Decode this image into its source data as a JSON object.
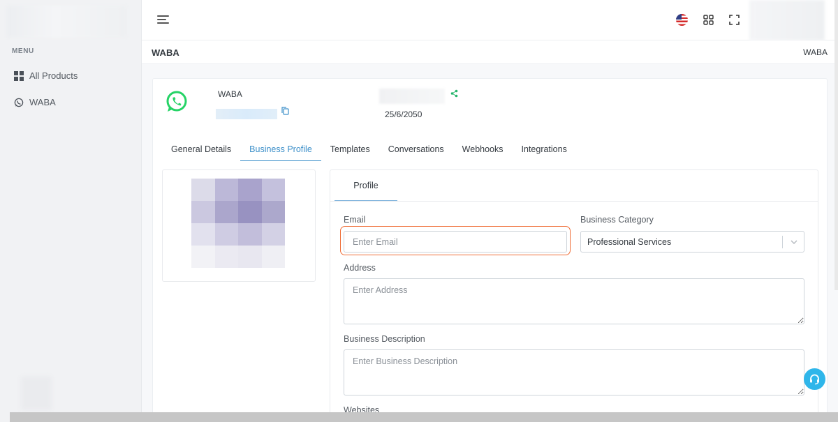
{
  "sidebar": {
    "menu_title": "MENU",
    "items": [
      {
        "label": "All Products",
        "icon": "grid-icon"
      },
      {
        "label": "WABA",
        "icon": "whatsapp-icon"
      }
    ]
  },
  "header": {
    "language_flag": "us-flag-icon"
  },
  "page": {
    "title": "WABA",
    "breadcrumb": "WABA"
  },
  "account": {
    "name": "WABA",
    "date": "25/6/2050",
    "brand_color": "#25d366"
  },
  "tabs": [
    {
      "label": "General Details",
      "active": false
    },
    {
      "label": "Business Profile",
      "active": true
    },
    {
      "label": "Templates",
      "active": false
    },
    {
      "label": "Conversations",
      "active": false
    },
    {
      "label": "Webhooks",
      "active": false
    },
    {
      "label": "Integrations",
      "active": false
    }
  ],
  "profile": {
    "tab_label": "Profile",
    "email_label": "Email",
    "email_placeholder": "Enter Email",
    "email_value": "",
    "category_label": "Business Category",
    "category_value": "Professional Services",
    "address_label": "Address",
    "address_placeholder": "Enter Address",
    "description_label": "Business Description",
    "description_placeholder": "Enter Business Description",
    "websites_label": "Websites"
  },
  "colors": {
    "accent": "#3c8fc9",
    "focus": "#ef6c35",
    "support": "#2fb6ea"
  }
}
